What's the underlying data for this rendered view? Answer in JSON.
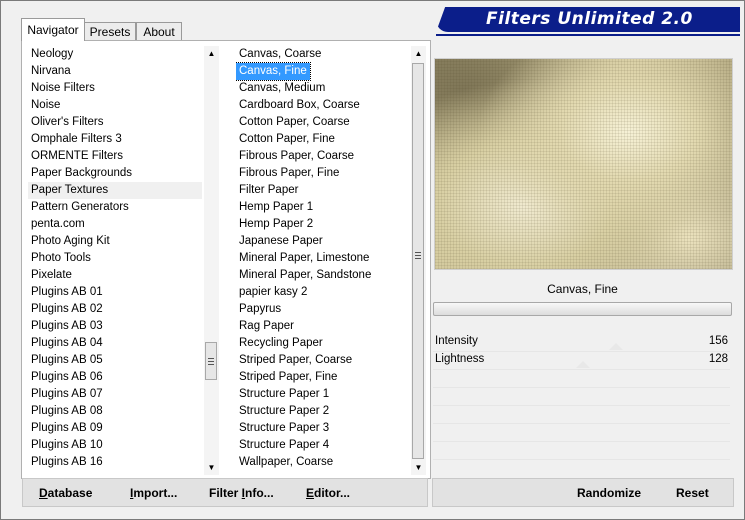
{
  "logo": {
    "text": "Filters Unlimited 2.0"
  },
  "tabs": [
    {
      "label": "Navigator",
      "active": true
    },
    {
      "label": "Presets",
      "active": false
    },
    {
      "label": "About",
      "active": false
    }
  ],
  "categories": {
    "items": [
      "Neology",
      "Nirvana",
      "Noise Filters",
      "Noise",
      "Oliver's Filters",
      "Omphale Filters 3",
      "ORMENTE Filters",
      "Paper Backgrounds",
      "Paper Textures",
      "Pattern Generators",
      "penta.com",
      "Photo Aging Kit",
      "Photo Tools",
      "Pixelate",
      "Plugins AB 01",
      "Plugins AB 02",
      "Plugins AB 03",
      "Plugins AB 04",
      "Plugins AB 05",
      "Plugins AB 06",
      "Plugins AB 07",
      "Plugins AB 08",
      "Plugins AB 09",
      "Plugins AB 10",
      "Plugins AB 16"
    ],
    "selected": "Paper Textures"
  },
  "filters": {
    "items": [
      "Canvas, Coarse",
      "Canvas, Fine",
      "Canvas, Medium",
      "Cardboard Box, Coarse",
      "Cotton Paper, Coarse",
      "Cotton Paper, Fine",
      "Fibrous Paper, Coarse",
      "Fibrous Paper, Fine",
      "Filter Paper",
      "Hemp Paper 1",
      "Hemp Paper 2",
      "Japanese Paper",
      "Mineral Paper, Limestone",
      "Mineral Paper, Sandstone",
      "papier kasy 2",
      "Papyrus",
      "Rag Paper",
      "Recycling Paper",
      "Striped Paper, Coarse",
      "Striped Paper, Fine",
      "Structure Paper 1",
      "Structure Paper 2",
      "Structure Paper 3",
      "Structure Paper 4",
      "Wallpaper, Coarse"
    ],
    "selected": "Canvas, Fine"
  },
  "preview": {
    "filter_name": "Canvas, Fine"
  },
  "parameters": [
    {
      "label": "Intensity",
      "value": "156"
    },
    {
      "label": "Lightness",
      "value": "128"
    }
  ],
  "buttons": {
    "database": {
      "pre": "",
      "u": "D",
      "post": "atabase"
    },
    "import": {
      "pre": "",
      "u": "I",
      "post": "mport..."
    },
    "filter_info": {
      "pre": "Filter ",
      "u": "I",
      "post": "nfo..."
    },
    "editor": {
      "pre": "",
      "u": "E",
      "post": "ditor..."
    },
    "randomize": {
      "pre": "",
      "u": "",
      "post": "Randomize"
    },
    "reset": {
      "pre": "",
      "u": "",
      "post": "Reset"
    }
  }
}
